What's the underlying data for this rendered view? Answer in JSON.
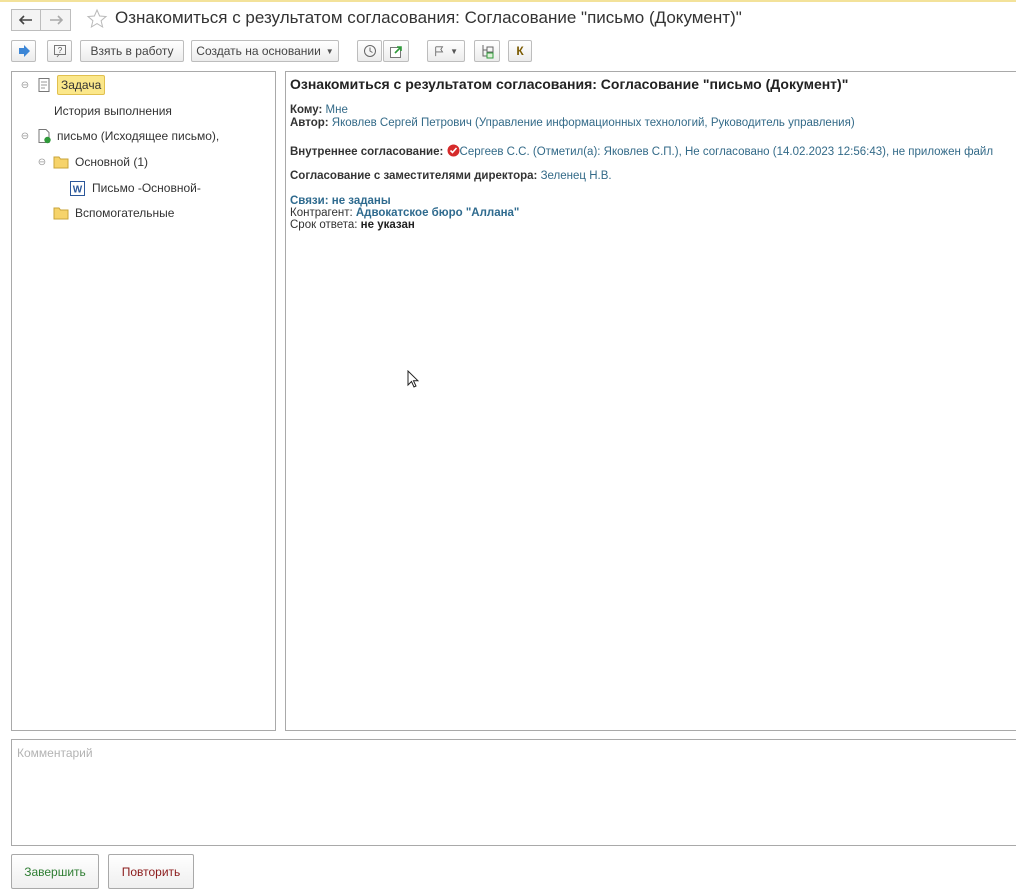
{
  "window": {
    "title": "Ознакомиться с результатом согласования: Согласование \"письмо (Документ)\""
  },
  "toolbar": {
    "take_to_work": "Взять в работу",
    "create_based_on": "Создать на основании",
    "k_label": "К"
  },
  "tree": {
    "items": [
      {
        "label": "Задача"
      },
      {
        "label": "История выполнения"
      },
      {
        "label": "письмо (Исходящее письмо),"
      },
      {
        "label": "Основной (1)"
      },
      {
        "label": "Письмо -Основной-"
      },
      {
        "label": "Вспомогательные"
      }
    ]
  },
  "content": {
    "heading": "Ознакомиться с результатом согласования: Согласование \"письмо (Документ)\"",
    "to_label": "Кому:",
    "to_value": "Мне",
    "author_label": "Автор:",
    "author_value": "Яковлев Сергей Петрович (Управление информационных технологий, Руководитель управления)",
    "internal_label": "Внутреннее согласование:",
    "internal_value": "Сергеев С.С. (Отметил(а): Яковлев С.П.), Не согласовано (14.02.2023 12:56:43), не приложен файл",
    "deputies_label": "Согласование с заместителями директора:",
    "deputies_value": "Зеленец Н.В.",
    "links_label": "Связи: не заданы",
    "counterparty_label": "Контрагент:",
    "counterparty_value": "Адвокатское бюро \"Аллана\"",
    "deadline_label": "Срок ответа:",
    "deadline_value": "не указан"
  },
  "comment": {
    "placeholder": "Комментарий"
  },
  "actions": {
    "complete": "Завершить",
    "repeat": "Повторить"
  },
  "colors": {
    "selection": "#fbe78a",
    "link": "#336a88",
    "complete_text": "#2e7d32",
    "repeat_text": "#8b1a1a",
    "status_red": "#d62b2b"
  }
}
